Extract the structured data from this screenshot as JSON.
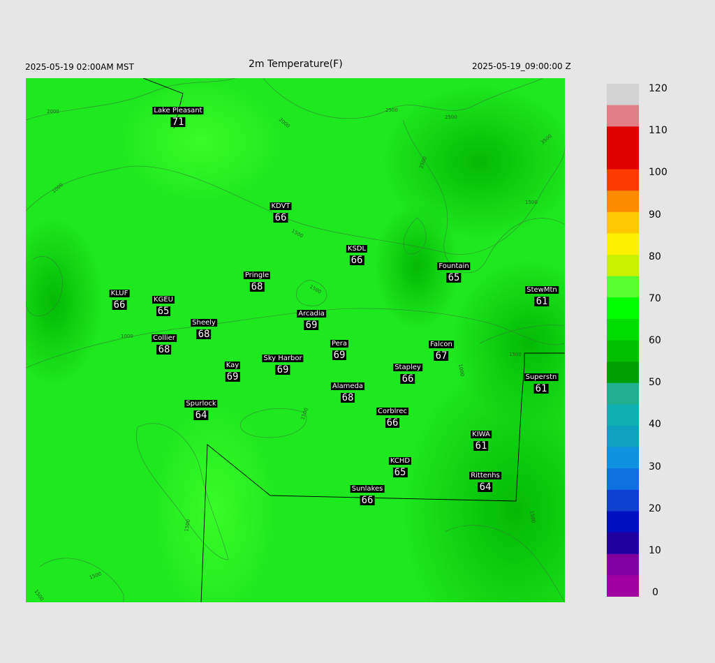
{
  "header": {
    "local_time": "2025-05-19 02:00AM MST",
    "title": "2m Temperature(F)",
    "utc_time": "2025-05-19_09:00:00 Z"
  },
  "contour_labels": [
    "2000",
    "2000",
    "2500",
    "2500",
    "2500",
    "3500",
    "1500",
    "1500",
    "1000",
    "1000",
    "1500",
    "1000",
    "1500",
    "1500",
    "1500",
    "1500",
    "1500",
    "1500"
  ],
  "stations": [
    {
      "name": "Lake Pleasant",
      "value": "71"
    },
    {
      "name": "KDVT",
      "value": "66"
    },
    {
      "name": "KSDL",
      "value": "66"
    },
    {
      "name": "Fountain",
      "value": "65"
    },
    {
      "name": "StewMtn",
      "value": "61"
    },
    {
      "name": "Pringle",
      "value": "68"
    },
    {
      "name": "KLUF",
      "value": "66"
    },
    {
      "name": "KGEU",
      "value": "65"
    },
    {
      "name": "Arcadia",
      "value": "69"
    },
    {
      "name": "Sheely",
      "value": "68"
    },
    {
      "name": "Collier",
      "value": "68"
    },
    {
      "name": "Pera",
      "value": "69"
    },
    {
      "name": "Falcon",
      "value": "67"
    },
    {
      "name": "Kay",
      "value": "69"
    },
    {
      "name": "Sky Harbor",
      "value": "69"
    },
    {
      "name": "Stapley",
      "value": "66"
    },
    {
      "name": "Superstn",
      "value": "61"
    },
    {
      "name": "Alameda",
      "value": "68"
    },
    {
      "name": "Spurlock",
      "value": "64"
    },
    {
      "name": "Corblrec",
      "value": "66"
    },
    {
      "name": "KIWA",
      "value": "61"
    },
    {
      "name": "KCHD",
      "value": "65"
    },
    {
      "name": "Rittenhs",
      "value": "64"
    },
    {
      "name": "Sunlakes",
      "value": "66"
    }
  ],
  "colorbar": {
    "labels": [
      "120",
      "110",
      "100",
      "90",
      "80",
      "70",
      "60",
      "50",
      "40",
      "30",
      "20",
      "10",
      "0"
    ],
    "range": [
      0,
      120
    ],
    "colors": {
      "120": "#d2d2d2",
      "115": "#e07f86",
      "110": "#e00000",
      "100": "#ff3a00",
      "95": "#ff8c00",
      "90": "#ffc800",
      "85": "#fff000",
      "80": "#c8f000",
      "75": "#5aff30",
      "70": "#00ff00",
      "65": "#00dc00",
      "60": "#00c000",
      "55": "#00a000",
      "50": "#20b090",
      "45": "#10b0b0",
      "40": "#10a0c0",
      "35": "#1090e0",
      "30": "#1070e0",
      "25": "#1040d0",
      "20": "#0010c0",
      "15": "#2000a0",
      "10": "#8000a0",
      "5": "#a000a0",
      "0": "#000000"
    }
  }
}
